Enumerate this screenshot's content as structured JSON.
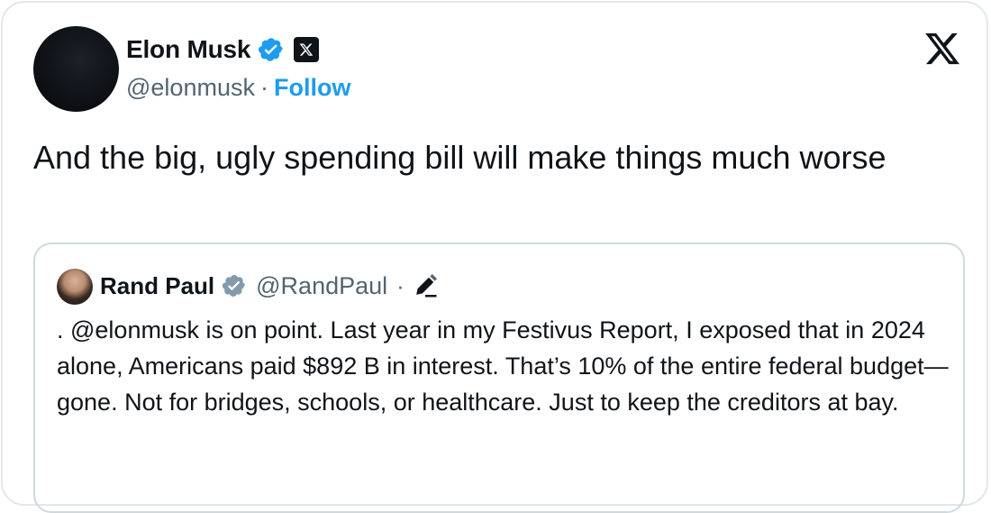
{
  "tweet": {
    "author_name": "Elon Musk",
    "author_handle": "@elonmusk",
    "separator": "·",
    "follow_label": "Follow",
    "text": "And the big, ugly spending bill will make things much worse"
  },
  "quoted_tweet": {
    "author_name": "Rand Paul",
    "author_handle": "@RandPaul",
    "separator": "·",
    "text": ". @elonmusk is on point. Last year in my Festivus Report, I exposed that in 2024 alone, Americans paid $892 B in interest. That’s 10% of the entire federal budget—gone. Not for bridges, schools, or healthcare. Just to keep the creditors at bay."
  },
  "icons": {
    "verified": "verified-badge-icon",
    "affiliate": "x-affiliate-badge-icon",
    "brand": "x-logo-icon",
    "edited": "pencil-icon"
  },
  "colors": {
    "accent": "#1d9bf0",
    "text": "#0f1419",
    "muted": "#536471",
    "gov_verified": "#829aab",
    "border": "#cfd9de"
  }
}
